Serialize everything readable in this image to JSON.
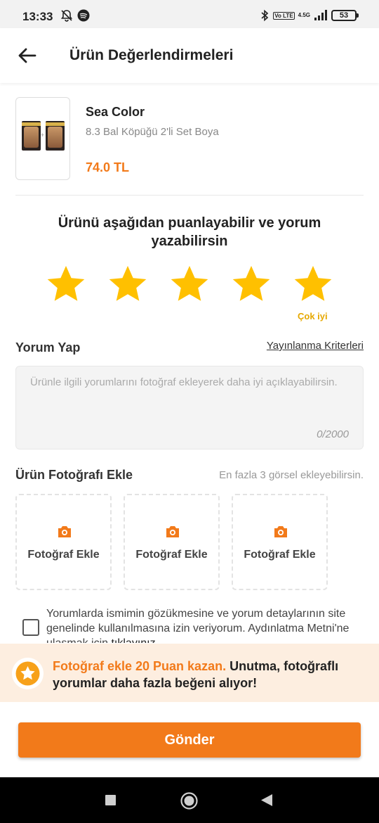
{
  "status_bar": {
    "time": "13:33",
    "network": "4.5G",
    "volte": "Vo LTE",
    "battery": "53",
    "icons": [
      "mute-bell-icon",
      "spotify-icon",
      "bluetooth-icon",
      "signal-icon",
      "battery-icon"
    ]
  },
  "app_bar": {
    "title": "Ürün Değerlendirmeleri",
    "back_icon": "arrow-left-icon"
  },
  "product": {
    "brand": "Sea Color",
    "name": "8.3 Bal Köpüğü 2'li Set Boya",
    "price": "74.0 TL"
  },
  "rating": {
    "prompt": "Ürünü aşağıdan puanlayabilir ve yorum yazabilirsin",
    "stars_selected": 5,
    "stars_total": 5,
    "selected_label": "Çok iyi",
    "star_color": "#ffc000"
  },
  "comment": {
    "title": "Yorum Yap",
    "criteria_link": "Yayınlanma Kriterleri",
    "placeholder": "Ürünle ilgili yorumlarını fotoğraf ekleyerek daha iyi açıklayabilirsin.",
    "value": "",
    "counter": "0/2000"
  },
  "photos": {
    "title": "Ürün Fotoğrafı Ekle",
    "hint": "En fazla 3 görsel ekleyebilirsin.",
    "slots": [
      {
        "label": "Fotoğraf Ekle",
        "icon": "camera-icon"
      },
      {
        "label": "Fotoğraf Ekle",
        "icon": "camera-icon"
      },
      {
        "label": "Fotoğraf Ekle",
        "icon": "camera-icon"
      }
    ]
  },
  "consent": {
    "checked": false,
    "text": "Yorumlarda ismimin gözükmesine ve yorum detaylarının site genelinde kullanılmasına izin veriyorum. Aydınlatma Metni'ne ulaşmak için ",
    "link": "tıklayınız"
  },
  "promo": {
    "highlight": "Fotoğraf ekle 20 Puan kazan.",
    "text": " Unutma, fotoğraflı yorumlar daha fazla beğeni alıyor!",
    "icon": "star-badge-icon"
  },
  "submit": {
    "label": "Gönder"
  },
  "colors": {
    "accent": "#f27a1a",
    "star": "#ffc000",
    "promo_bg": "#fdeee0"
  }
}
